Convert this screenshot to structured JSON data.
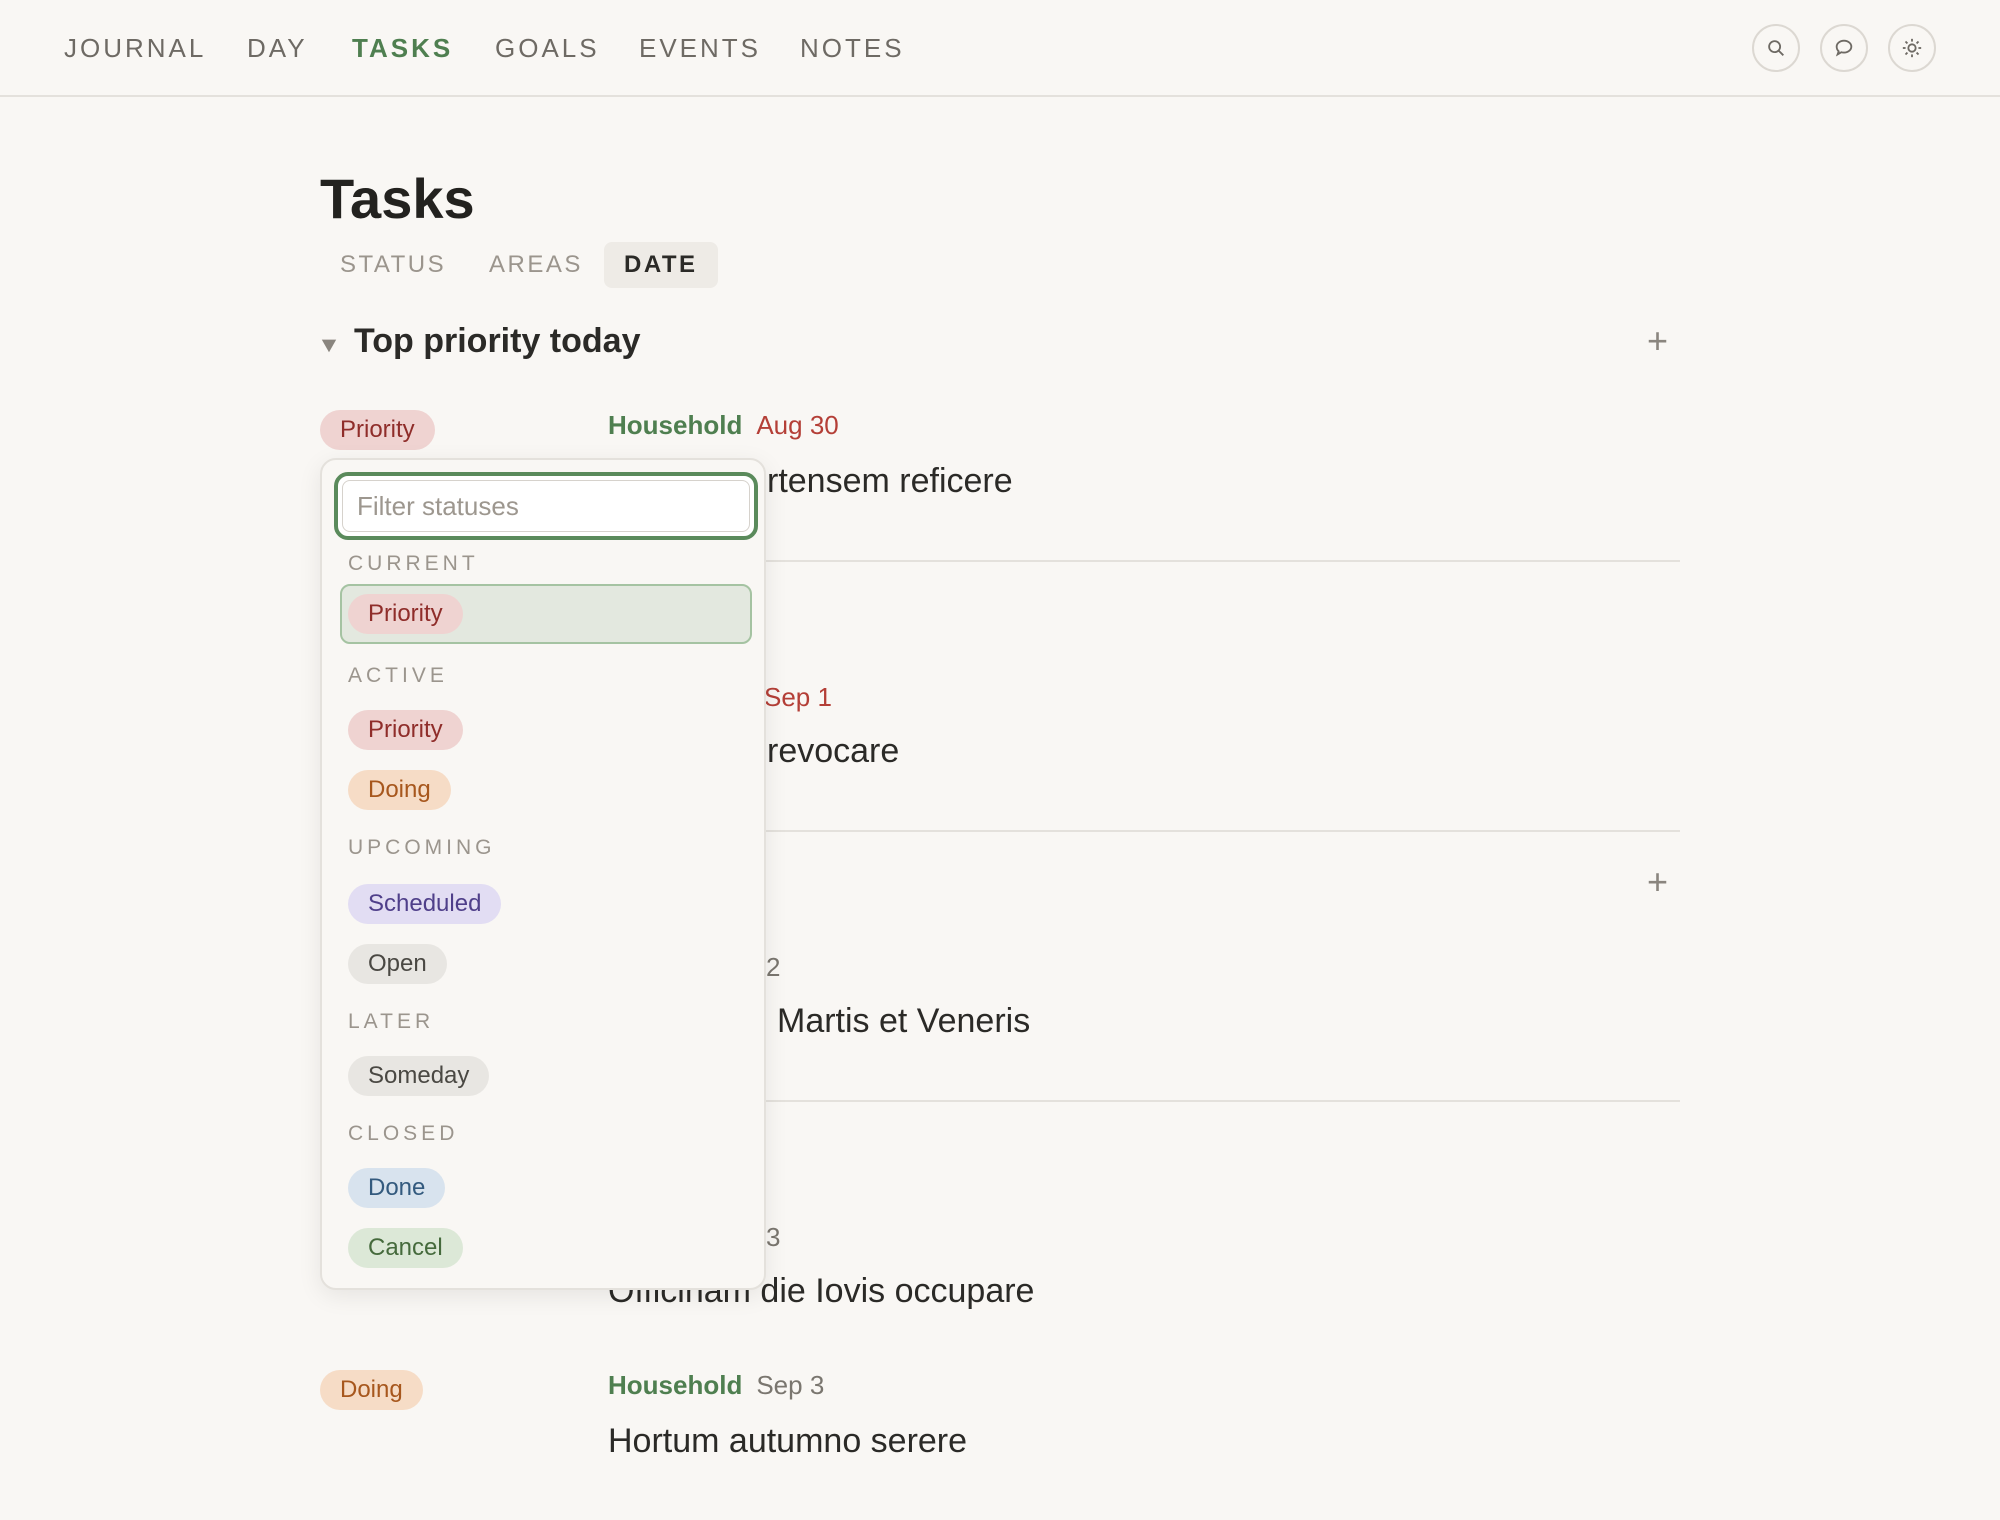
{
  "nav": {
    "items": [
      "JOURNAL",
      "DAY",
      "TASKS",
      "GOALS",
      "EVENTS",
      "NOTES"
    ],
    "active": "TASKS",
    "icons": [
      "search-icon",
      "chat-icon",
      "sun-icon"
    ]
  },
  "page": {
    "title": "Tasks",
    "tabs": [
      "STATUS",
      "AREAS",
      "DATE"
    ],
    "active_tab": "DATE"
  },
  "section": {
    "title": "Top priority today"
  },
  "tasks": [
    {
      "status": "Priority",
      "area": "Household",
      "date": "Aug 30",
      "title_visible": "rtensem reficere"
    },
    {
      "date_visible": "Sep 1",
      "title_visible": "revocare"
    },
    {
      "date_visible": "2",
      "title_visible": "Martis et Veneris"
    },
    {
      "date_visible": "3",
      "title_visible": "Officinam die Iovis occupare"
    },
    {
      "status": "Doing",
      "area": "Household",
      "date": "Sep 3",
      "title": "Hortum autumno serere"
    }
  ],
  "dropdown": {
    "placeholder": "Filter statuses",
    "groups": {
      "current": {
        "label": "CURRENT",
        "options": [
          "Priority"
        ]
      },
      "active": {
        "label": "ACTIVE",
        "options": [
          "Priority",
          "Doing"
        ]
      },
      "upcoming": {
        "label": "UPCOMING",
        "options": [
          "Scheduled",
          "Open"
        ]
      },
      "later": {
        "label": "LATER",
        "options": [
          "Someday"
        ]
      },
      "closed": {
        "label": "CLOSED",
        "options": [
          "Done",
          "Cancel"
        ]
      }
    }
  },
  "colors": {
    "accent_green": "#4f7f50",
    "date_red": "#b43f37",
    "background": "#f9f7f4"
  }
}
